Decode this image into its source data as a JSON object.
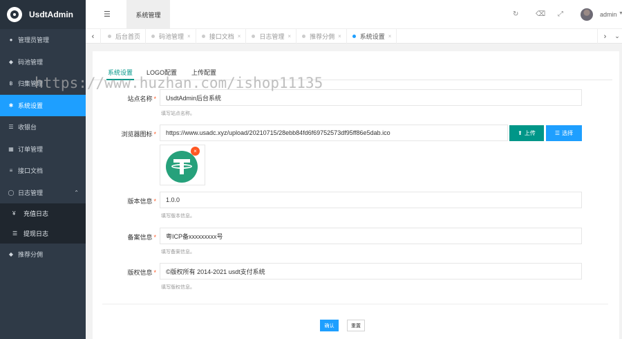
{
  "app": {
    "name": "UsdtAdmin"
  },
  "sidebar": {
    "items": [
      {
        "label": "管理员管理",
        "icon": "user-icon"
      },
      {
        "label": "码池管理",
        "icon": "diamond-icon"
      },
      {
        "label": "归集管理",
        "icon": "bitcoin-icon"
      },
      {
        "label": "系统设置",
        "icon": "gear-icon",
        "active": true
      },
      {
        "label": "收银台",
        "icon": "list-icon"
      },
      {
        "label": "订单管理",
        "icon": "table-icon"
      },
      {
        "label": "接口文档",
        "icon": "align-icon"
      },
      {
        "label": "日志管理",
        "icon": "clock-icon",
        "expanded": true
      }
    ],
    "sub_items": [
      {
        "label": "充值日志",
        "icon": "yen-icon"
      },
      {
        "label": "提现日志",
        "icon": "list-icon"
      }
    ],
    "last_item": {
      "label": "推荐分佣",
      "icon": "diamond-icon"
    }
  },
  "header": {
    "current_tab": "系统管理",
    "user": "admin"
  },
  "tabs": [
    {
      "label": "后台首页",
      "closable": false
    },
    {
      "label": "码池管理",
      "closable": true
    },
    {
      "label": "接口文档",
      "closable": true
    },
    {
      "label": "日志管理",
      "closable": true
    },
    {
      "label": "推荐分佣",
      "closable": true
    },
    {
      "label": "系统设置",
      "closable": true,
      "active": true
    }
  ],
  "tab_close_glyph": "×",
  "form_tabs": [
    "系统设置",
    "LOGO配置",
    "上传配置"
  ],
  "form": {
    "required_mark": "*",
    "site_name": {
      "label": "站点名称",
      "value": "UsdtAdmin后台系统",
      "tip": "填写站点名称。"
    },
    "favicon": {
      "label": "浏览器图标",
      "value": "https://www.usadc.xyz/upload/20210715/28ebb84fd6f69752573df95ff86e5dab.ico"
    },
    "version": {
      "label": "版本信息",
      "value": "1.0.0",
      "tip": "填写版本信息。"
    },
    "icp": {
      "label": "备案信息",
      "value": "粤ICP备xxxxxxxxx号",
      "tip": "填写备案信息。"
    },
    "copyright": {
      "label": "版权信息",
      "value": "©版权所有 2014-2021 usdt支付系统",
      "tip": "填写版权信息。"
    }
  },
  "buttons": {
    "upload": "上传",
    "select": "选择",
    "confirm": "确认",
    "reset": "重置"
  },
  "watermark": "https://www.huzhan.com/ishop11135",
  "colors": {
    "sidebar_bg": "#2f3a47",
    "accent_blue": "#1e9fff",
    "accent_green": "#009688",
    "required_red": "#ff5722"
  }
}
